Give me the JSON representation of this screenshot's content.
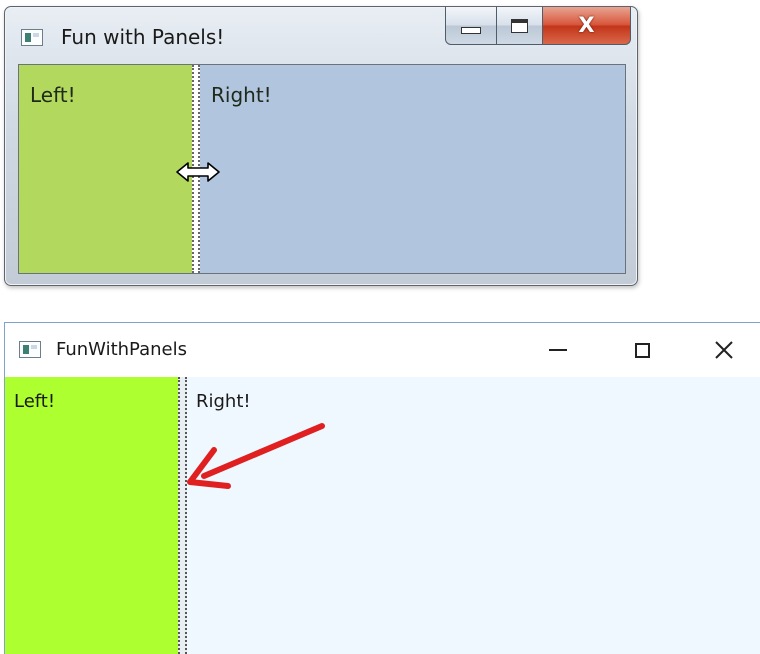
{
  "colors": {
    "win7_left_panel": "#b2d85d",
    "win7_right_panel": "#b1c5de",
    "win10_left_panel": "#adff2f",
    "win10_right_panel": "#f0f8ff",
    "annotation_arrow": "#e02020",
    "close_button": "#c9431f"
  },
  "win7_window": {
    "title": "Fun with Panels!",
    "app_icon": "window-app-icon",
    "controls": {
      "minimize_icon": "minimize-icon",
      "maximize_icon": "maximize-icon",
      "close_label": "X"
    },
    "left_panel": {
      "label": "Left!"
    },
    "right_panel": {
      "label": "Right!"
    },
    "cursor_icon": "resize-horizontal-cursor-icon"
  },
  "win10_window": {
    "title": "FunWithPanels",
    "app_icon": "window-app-icon",
    "controls": {
      "minimize_icon": "minimize-icon",
      "maximize_icon": "maximize-icon",
      "close_icon": "close-icon"
    },
    "left_panel": {
      "label": "Left!"
    },
    "right_panel": {
      "label": "Right!"
    },
    "annotation_icon": "red-arrow-icon"
  }
}
